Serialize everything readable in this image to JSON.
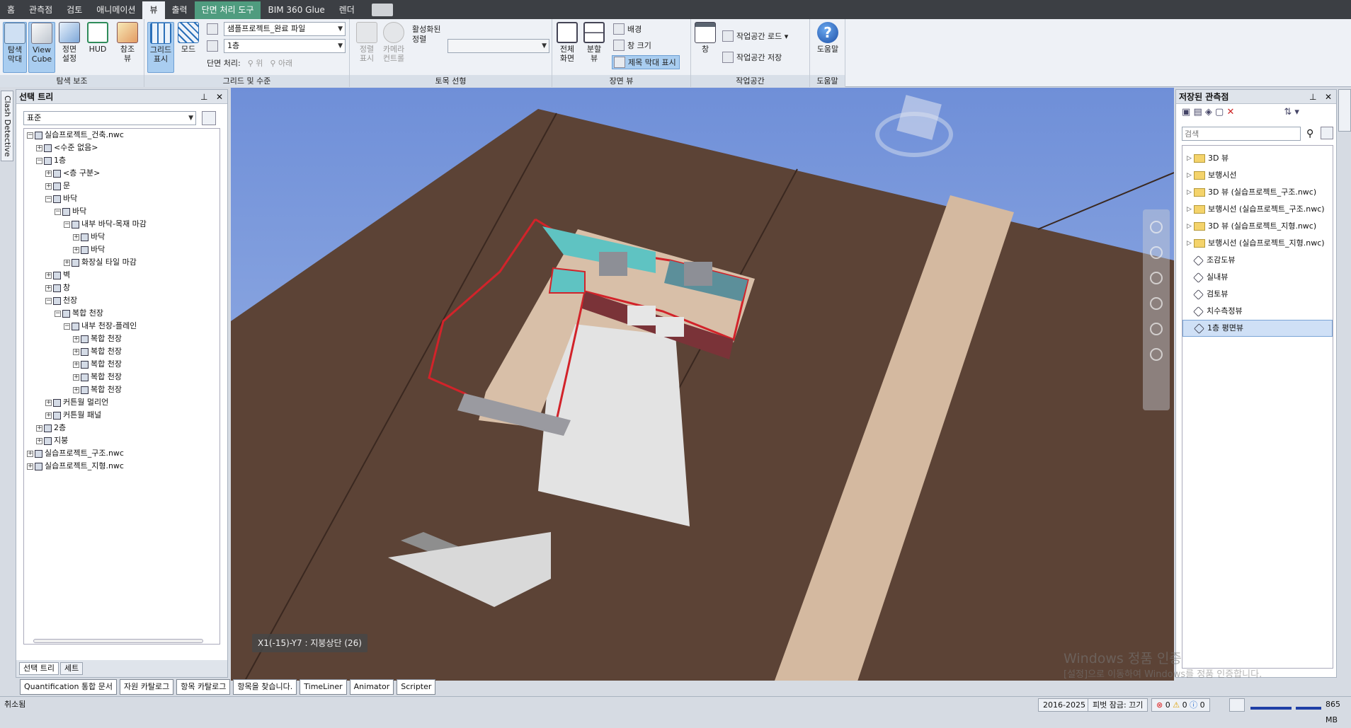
{
  "ribbon_tabs": [
    "홈",
    "관측점",
    "검토",
    "애니메이션",
    "뷰",
    "출력",
    "단면 처리 도구",
    "BIM 360 Glue",
    "렌더"
  ],
  "active_tab": "뷰",
  "context_tab": "단면 처리 도구",
  "ribbon": {
    "nav_aids": {
      "title": "탐색 보조",
      "buttons": [
        "탐색\n막대",
        "View\nCube",
        "정면\n설정",
        "HUD",
        "참조\n뷰"
      ]
    },
    "grid": {
      "title": "그리드 및 수준",
      "grid_btn": "그리드\n표시",
      "mode_btn": "모드",
      "file_combo": "샘플프로젝트_완료 파일",
      "level_combo": "1층",
      "section_label": "단면 처리:",
      "up": "위",
      "down": "아래"
    },
    "stereo": {
      "title": "토목 선형",
      "align_show": "정렬\n표시",
      "camera": "카메라\n컨트롤",
      "active_align": "활성화된\n정렬"
    },
    "scene": {
      "title": "장면 뷰",
      "full": "전체\n화면",
      "split": "분할\n뷰",
      "background": "배경",
      "window_size": "창 크기",
      "title_bar": "제목 막대 표시"
    },
    "workspace": {
      "title": "작업공간",
      "window": "창",
      "load": "작업공간 로드",
      "save": "작업공간 저장"
    },
    "help": {
      "title": "도움말",
      "label": "도움말"
    }
  },
  "left_strip_tab": "Clash Detective",
  "selection_tree": {
    "title": "선택 트리",
    "combo": "표준",
    "nodes": [
      {
        "d": 0,
        "t": "-",
        "l": "실습프로젝트_건축.nwc"
      },
      {
        "d": 1,
        "t": "+",
        "l": "<수준 없음>"
      },
      {
        "d": 1,
        "t": "-",
        "l": "1층"
      },
      {
        "d": 2,
        "t": "+",
        "l": "<층 구분>"
      },
      {
        "d": 2,
        "t": "+",
        "l": "문"
      },
      {
        "d": 2,
        "t": "-",
        "l": "바닥"
      },
      {
        "d": 3,
        "t": "-",
        "l": "바닥"
      },
      {
        "d": 4,
        "t": "-",
        "l": "내부 바닥-목재 마감"
      },
      {
        "d": 5,
        "t": "+",
        "l": "바닥"
      },
      {
        "d": 5,
        "t": "+",
        "l": "바닥"
      },
      {
        "d": 4,
        "t": "+",
        "l": "화장실 타일 마감"
      },
      {
        "d": 2,
        "t": "+",
        "l": "벽"
      },
      {
        "d": 2,
        "t": "+",
        "l": "창"
      },
      {
        "d": 2,
        "t": "-",
        "l": "천장"
      },
      {
        "d": 3,
        "t": "-",
        "l": "복합 천장"
      },
      {
        "d": 4,
        "t": "-",
        "l": "내부 천장-플레인"
      },
      {
        "d": 5,
        "t": "+",
        "l": "복합 천장"
      },
      {
        "d": 5,
        "t": "+",
        "l": "복합 천장"
      },
      {
        "d": 5,
        "t": "+",
        "l": "복합 천장"
      },
      {
        "d": 5,
        "t": "+",
        "l": "복합 천장"
      },
      {
        "d": 5,
        "t": "+",
        "l": "복합 천장"
      },
      {
        "d": 2,
        "t": "+",
        "l": "커튼월 멀리언"
      },
      {
        "d": 2,
        "t": "+",
        "l": "커튼월 패널"
      },
      {
        "d": 1,
        "t": "+",
        "l": "2층"
      },
      {
        "d": 1,
        "t": "+",
        "l": "지붕"
      },
      {
        "d": 0,
        "t": "+",
        "l": "실습프로젝트_구조.nwc"
      },
      {
        "d": 0,
        "t": "+",
        "l": "실습프로젝트_지형.nwc"
      }
    ],
    "tabs": [
      "선택 트리",
      "세트"
    ]
  },
  "viewport": {
    "coord_label": "X1(-15)-Y7 : 지붕상단 (26)"
  },
  "saved_views": {
    "title": "저장된 관측점",
    "search_placeholder": "검색",
    "items": [
      {
        "type": "folder",
        "label": "3D 뷰"
      },
      {
        "type": "folder",
        "label": "보행시선"
      },
      {
        "type": "folder",
        "label": "3D 뷰 (실습프로젝트_구조.nwc)"
      },
      {
        "type": "folder",
        "label": "보행시선 (실습프로젝트_구조.nwc)"
      },
      {
        "type": "folder",
        "label": "3D 뷰 (실습프로젝트_지형.nwc)"
      },
      {
        "type": "folder",
        "label": "보행시선 (실습프로젝트_지형.nwc)"
      },
      {
        "type": "view",
        "label": "조감도뷰"
      },
      {
        "type": "view",
        "label": "실내뷰"
      },
      {
        "type": "view",
        "label": "검토뷰"
      },
      {
        "type": "view",
        "label": "치수측정뷰"
      },
      {
        "type": "view",
        "label": "1층 평면뷰",
        "selected": true
      }
    ]
  },
  "watermark": {
    "line1": "Windows 정품 인증",
    "line2": "[설정]으로 이동하여 Windows를 정품 인증합니다."
  },
  "bottom_tabs": [
    "Quantification 통합 문서",
    "자원 카탈로그",
    "항목 카탈로그",
    "항목을 찾습니다.",
    "TimeLiner",
    "Animator",
    "Scripter"
  ],
  "status": {
    "left": "취소됨",
    "sheet": "2016-2025",
    "pivot": "피벗 잠금: 끄기",
    "err": "0",
    "warn": "0",
    "info": "0",
    "memory": "865 MB"
  }
}
